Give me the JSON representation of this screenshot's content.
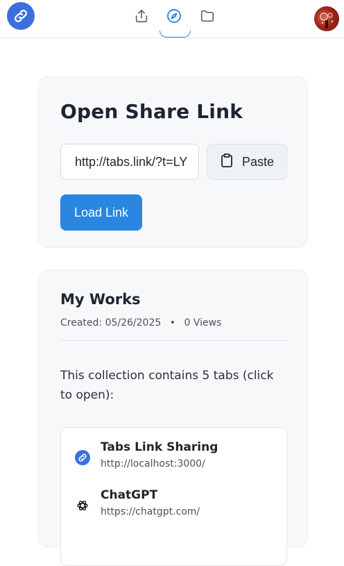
{
  "header": {
    "nav": [
      {
        "name": "share-icon",
        "active": false
      },
      {
        "name": "compass-icon",
        "active": true
      },
      {
        "name": "folder-icon",
        "active": false
      }
    ],
    "accent_color": "#3b6fe0",
    "active_underline_color": "#2f86d9"
  },
  "open_share": {
    "title": "Open Share Link",
    "url_value": "http://tabs.link/?t=LY",
    "paste_label": "Paste",
    "load_label": "Load Link",
    "load_color": "#2a86e0"
  },
  "collection": {
    "title": "My Works",
    "created": "Created: 05/26/2025",
    "separator": "•",
    "views": "0 Views",
    "description": "This collection contains 5 tabs (click to open):",
    "tabs": [
      {
        "title": "Tabs Link Sharing",
        "url": "http://localhost:3000/",
        "icon": "link-favicon-icon"
      },
      {
        "title": "ChatGPT",
        "url": "https://chatgpt.com/",
        "icon": "openai-favicon-icon"
      }
    ]
  }
}
